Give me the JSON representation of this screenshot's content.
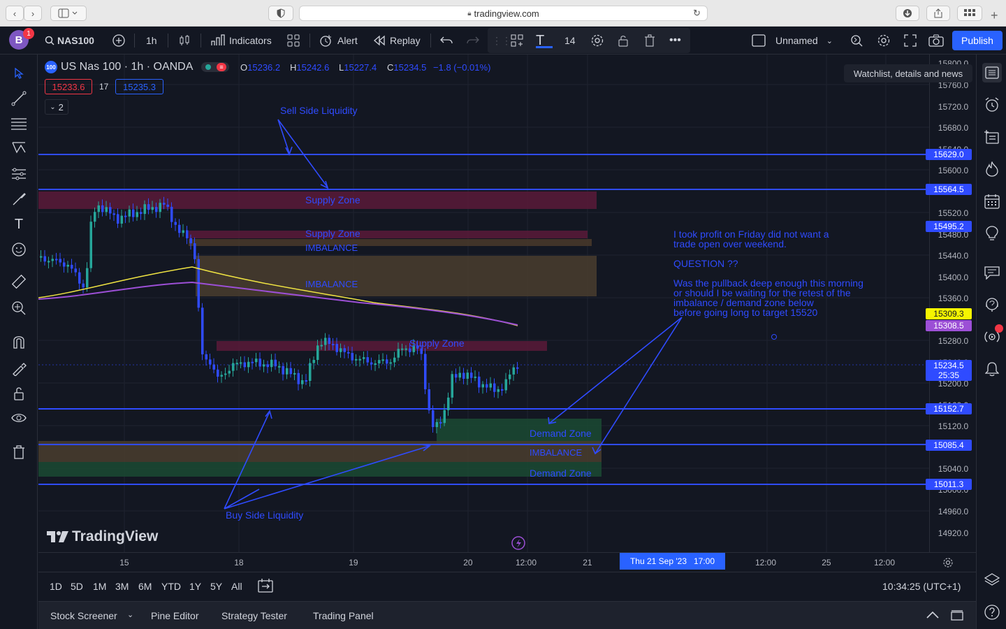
{
  "browser": {
    "url": "tradingview.com",
    "back": "‹",
    "forward": "›"
  },
  "toolbar": {
    "avatar_letter": "B",
    "notification_count": "1",
    "symbol": "NAS100",
    "interval": "1h",
    "indicators": "Indicators",
    "alert": "Alert",
    "replay": "Replay",
    "font_size": "14",
    "layout_name": "Unnamed",
    "publish": "Publish"
  },
  "legend": {
    "title": "US Nas 100 · 1h · OANDA",
    "logo": "100",
    "o_label": "O",
    "o_value": "15236.2",
    "h_label": "H",
    "h_value": "15242.6",
    "l_label": "L",
    "l_value": "15227.4",
    "c_label": "C",
    "c_value": "15234.5",
    "change": "−1.8 (−0.01%)",
    "bid": "15233.6",
    "spread": "17",
    "ask": "15235.3",
    "indicator_count": "2"
  },
  "tooltip": "Watchlist, details and news",
  "price_axis": {
    "ticks": [
      "15800.0",
      "15760.0",
      "15720.0",
      "15680.0",
      "15640.0",
      "15600.0",
      "15520.0",
      "15480.0",
      "15440.0",
      "15400.0",
      "15360.0",
      "15280.0",
      "15240.0",
      "15200.0",
      "15160.0",
      "15120.0",
      "15040.0",
      "15000.0",
      "14960.0",
      "14920.0"
    ],
    "tags": [
      {
        "label": "15629.0",
        "color": "#2f4bff"
      },
      {
        "label": "15564.5",
        "color": "#2f4bff"
      },
      {
        "label": "15495.2",
        "color": "#2f4bff"
      },
      {
        "label": "15309.3",
        "color": "#f5f500"
      },
      {
        "label": "15308.5",
        "color": "#9c4fd6"
      },
      {
        "label": "15234.5",
        "color": "#2f4bff"
      },
      {
        "label": "15152.7",
        "color": "#2f4bff"
      },
      {
        "label": "15085.4",
        "color": "#2f4bff"
      },
      {
        "label": "15011.3",
        "color": "#2f4bff"
      }
    ],
    "countdown": "25:35"
  },
  "time_axis": {
    "labels": [
      "15",
      "18",
      "19",
      "20",
      "12:00",
      "21",
      "12:00",
      "25",
      "12:00"
    ],
    "crosshair_label": "Thu 21 Sep '23   17:00"
  },
  "range_bar": {
    "ranges": [
      "1D",
      "5D",
      "1M",
      "3M",
      "6M",
      "YTD",
      "1Y",
      "5Y",
      "All"
    ],
    "clock": "10:34:25 (UTC+1)"
  },
  "bottom_bar": {
    "tabs": [
      "Stock Screener",
      "Pine Editor",
      "Strategy Tester",
      "Trading Panel"
    ]
  },
  "annotations": {
    "sell_side": "Sell Side Liquidity",
    "buy_side": "Buy Side Liquidity",
    "supply_zone": "Supply Zone",
    "imbalance": "IMBALANCE",
    "demand_zone": "Demand Zone",
    "note_lines": [
      "I took profit on Friday did not want a",
      "trade open over weekend.",
      "",
      "QUESTION ??",
      "",
      "Was the pullback deep enough this morning",
      "or should I be waiting for the retest of the",
      "imbalance / demand zone below",
      "before going long to target 15520"
    ]
  },
  "watermark": "TradingView",
  "colors": {
    "accent": "#2962ff",
    "drawing_blue": "#2f4bff",
    "up_candle": "#26a69a",
    "down_candle": "#2f4bff",
    "ma_yellow": "#f0e442",
    "ma_purple": "#9c4fd6"
  }
}
